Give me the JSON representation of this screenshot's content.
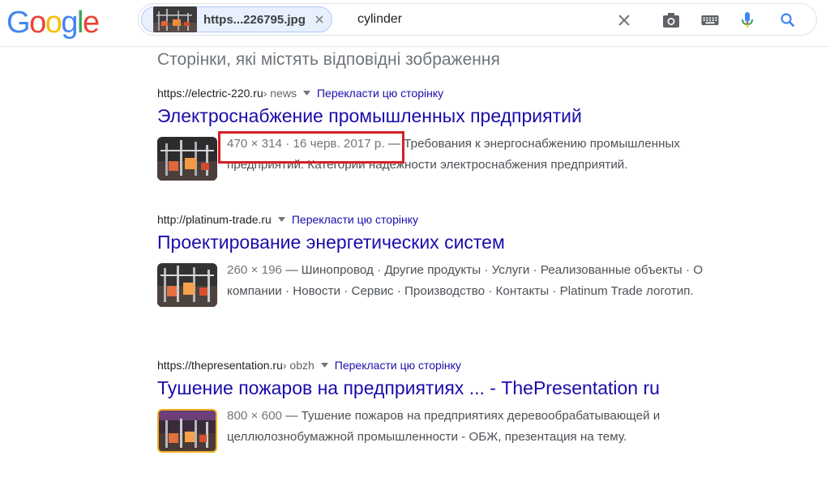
{
  "header": {
    "logo": [
      "G",
      "o",
      "o",
      "g",
      "l",
      "e"
    ],
    "logo_colors": [
      "#4285F4",
      "#EA4335",
      "#FBBC05",
      "#4285F4",
      "#34A853",
      "#EA4335"
    ],
    "image_chip_label": "https...226795.jpg",
    "query": "cylinder"
  },
  "icons": [
    "close-icon",
    "camera-icon",
    "keyboard-icon",
    "microphone-icon",
    "search-icon"
  ],
  "section_title": "Сторінки, які містять відповідні зображення",
  "results": [
    {
      "cite": "https://electric-220.ru",
      "path": " › news",
      "translate": "Перекласти цю сторінку",
      "title": "Электроснабжение промышленных предприятий",
      "meta": "470 × 314 · 16 черв. 2017 р.",
      "snippet": " — Требования к энергоснабжению промышленных предприятий. Категории надежности электроснабжения предприятий."
    },
    {
      "cite": "http://platinum-trade.ru",
      "path": "",
      "translate": "Перекласти цю сторінку",
      "title": "Проектирование энергетических систем",
      "meta": "260 × 196",
      "snippet": " — Шинопровод · Другие продукты · Услуги · Реализованные объекты · О компании · Новости · Сервис · Производство · Контакты · Platinum Trade логотип."
    },
    {
      "cite": "https://thepresentation.ru",
      "path": " › obzh",
      "translate": "Перекласти цю сторінку",
      "title": "Тушение пожаров на предприятиях ... - ThePresentation ru",
      "meta": "800 × 600",
      "snippet": " — Тушение пожаров на предприятиях деревообрабатывающей и целлюлознобумажной промышленности - ОБЖ, презентация на тему."
    }
  ],
  "colors": {
    "link": "#1a0dab",
    "highlight_box": "#d62027",
    "chip_bg": "#e8f0fe"
  }
}
